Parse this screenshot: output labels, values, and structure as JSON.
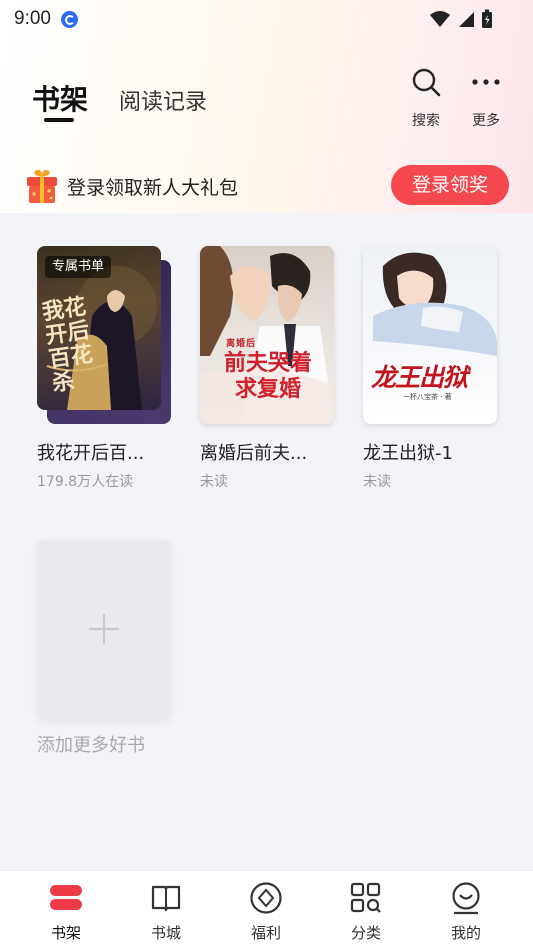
{
  "status_bar": {
    "time": "9:00"
  },
  "header": {
    "tab_shelf": "书架",
    "tab_history": "阅读记录",
    "search_label": "搜索",
    "more_label": "更多"
  },
  "promo": {
    "text": "登录领取新人大礼包",
    "button": "登录领奖"
  },
  "books": [
    {
      "tag": "专属书单",
      "title": "我花开后百...",
      "subtitle": "179.8万人在读",
      "cover_text": "我花开后百花杀"
    },
    {
      "title": "离婚后前夫...",
      "subtitle": "未读",
      "cover_text": "前夫哭着求复婚",
      "cover_top": "离婚后"
    },
    {
      "title": "龙王出狱-1",
      "subtitle": "未读",
      "cover_text": "龙王出狱",
      "cover_author": "一杯八宝茶 · 著"
    }
  ],
  "add_more": {
    "label": "添加更多好书"
  },
  "bottom_nav": [
    {
      "label": "书架",
      "icon": "bookshelf-icon",
      "active": true
    },
    {
      "label": "书城",
      "icon": "book-open-icon"
    },
    {
      "label": "福利",
      "icon": "welfare-icon"
    },
    {
      "label": "分类",
      "icon": "category-icon"
    },
    {
      "label": "我的",
      "icon": "profile-icon"
    }
  ],
  "colors": {
    "accent": "#f5474e",
    "active_nav": "#ef3b47"
  }
}
